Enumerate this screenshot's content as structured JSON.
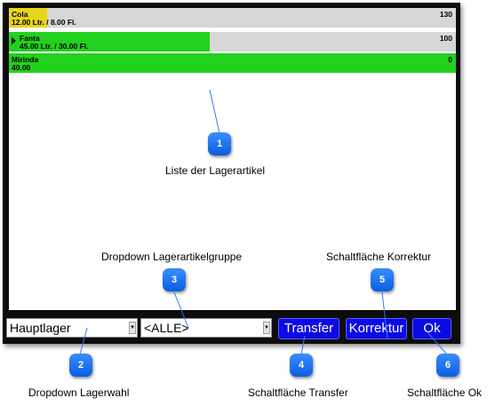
{
  "stock_list": {
    "items": [
      {
        "name": "Cola",
        "detail": "12.00 Ltr.  /  8.00 Fl.",
        "count": "130",
        "fill_fraction": 0.085,
        "fill_color": "#e8d51a",
        "expand_arrow": false
      },
      {
        "name": "Fanta",
        "detail": "45.00 Ltr.  /  30.00 Fl.",
        "count": "100",
        "fill_fraction": 0.45,
        "fill_color": "#22d11d",
        "expand_arrow": true
      },
      {
        "name": "Mirinda",
        "detail": "40.00",
        "count": "0",
        "fill_fraction": 1.0,
        "fill_color": "#22d11d",
        "expand_arrow": false
      }
    ]
  },
  "controls": {
    "warehouse_select": {
      "value": "Hauptlager"
    },
    "group_select": {
      "value": "<ALLE>"
    },
    "transfer_button": "Transfer",
    "correction_button": "Korrektur",
    "ok_button": "Ok"
  },
  "annotations": [
    {
      "number": "1",
      "label": "Liste der Lagerartikel"
    },
    {
      "number": "2",
      "label": "Dropdown Lagerwahl"
    },
    {
      "number": "3",
      "label": "Dropdown Lagerartikelgruppe"
    },
    {
      "number": "4",
      "label": "Schaltfläche Transfer"
    },
    {
      "number": "5",
      "label": "Schaltfläche Korrektur"
    },
    {
      "number": "6",
      "label": "Schaltfläche Ok"
    }
  ],
  "colors": {
    "accent": "#0a0ae6",
    "callout": "#1f75f0",
    "frame": "#0d0d0d"
  }
}
